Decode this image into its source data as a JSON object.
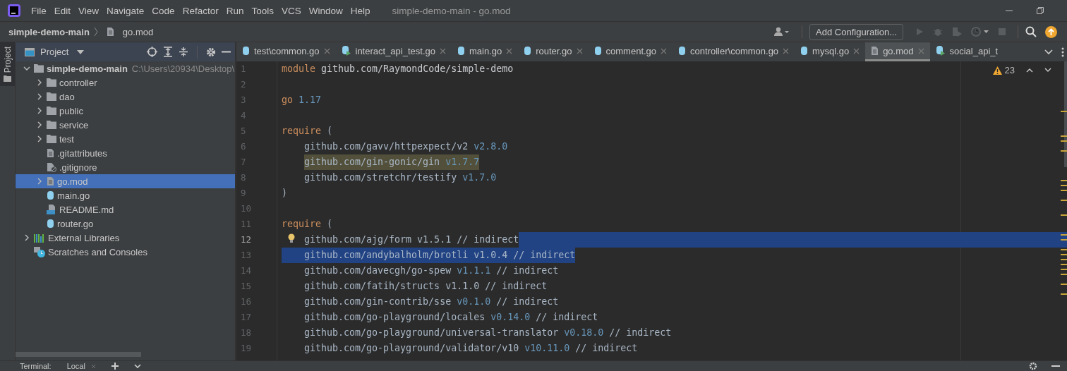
{
  "menu": [
    "File",
    "Edit",
    "View",
    "Navigate",
    "Code",
    "Refactor",
    "Run",
    "Tools",
    "VCS",
    "Window",
    "Help"
  ],
  "window_title": "simple-demo-main - go.mod",
  "breadcrumb": [
    {
      "label": "simple-demo-main",
      "kind": "project"
    },
    {
      "label": "go.mod",
      "kind": "file"
    }
  ],
  "toolbar": {
    "run_configuration": "Add Configuration..."
  },
  "side_tab": "Project",
  "project_panel": {
    "title": "Project",
    "tree": [
      {
        "label": "simple-demo-main",
        "path": "C:\\Users\\20934\\Desktop\\",
        "kind": "folder",
        "expanded": true,
        "selected": false,
        "children": [
          {
            "label": "controller",
            "kind": "folder",
            "expanded": false,
            "selected": false
          },
          {
            "label": "dao",
            "kind": "folder",
            "expanded": false,
            "selected": false
          },
          {
            "label": "public",
            "kind": "folder",
            "expanded": false,
            "selected": false
          },
          {
            "label": "service",
            "kind": "folder",
            "expanded": false,
            "selected": false
          },
          {
            "label": "test",
            "kind": "folder",
            "expanded": false,
            "selected": false
          },
          {
            "label": ".gitattributes",
            "kind": "file",
            "selected": false
          },
          {
            "label": ".gitignore",
            "kind": "ignored",
            "selected": false
          },
          {
            "label": "go.mod",
            "kind": "file",
            "expanded": false,
            "selected": true
          },
          {
            "label": "main.go",
            "kind": "go",
            "selected": false
          },
          {
            "label": "README.md",
            "kind": "markdown",
            "selected": false
          },
          {
            "label": "router.go",
            "kind": "go",
            "selected": false
          }
        ]
      },
      {
        "label": "External Libraries",
        "kind": "library",
        "expanded": false,
        "selected": false
      },
      {
        "label": "Scratches and Consoles",
        "kind": "scratches",
        "selected": false
      }
    ]
  },
  "tabs": [
    {
      "label": "test\\common.go",
      "kind": "go",
      "selected": false
    },
    {
      "label": "interact_api_test.go",
      "kind": "gotest",
      "selected": false
    },
    {
      "label": "main.go",
      "kind": "go",
      "selected": false
    },
    {
      "label": "router.go",
      "kind": "go",
      "selected": false
    },
    {
      "label": "comment.go",
      "kind": "go",
      "selected": false
    },
    {
      "label": "controller\\common.go",
      "kind": "go",
      "selected": false
    },
    {
      "label": "mysql.go",
      "kind": "go",
      "selected": false
    },
    {
      "label": "go.mod",
      "kind": "file",
      "selected": true
    },
    {
      "label": "social_api_t",
      "kind": "gotest",
      "selected": false
    }
  ],
  "editor": {
    "warnings": "23",
    "lines": [
      {
        "number": "1",
        "kind": "top",
        "tokens": [
          {
            "text": "module",
            "kind": "keyword"
          },
          {
            "text": " github.com/RaymondCode/simple-demo",
            "kind": "name"
          }
        ]
      },
      {
        "number": "2",
        "kind": "top"
      },
      {
        "number": "3",
        "kind": "top",
        "tokens": [
          {
            "text": "go",
            "kind": "keyword"
          },
          {
            "text": " 1.17",
            "kind": "version"
          }
        ]
      },
      {
        "number": "4",
        "kind": "top"
      },
      {
        "number": "5",
        "kind": "top",
        "tokens": [
          {
            "text": "require",
            "kind": "keyword"
          },
          {
            "text": " (",
            "kind": "text"
          }
        ]
      },
      {
        "number": "6",
        "kind": "nested",
        "tokens": [
          {
            "text": "github.com/gavv/httpexpect/v2 ",
            "kind": "text"
          },
          {
            "text": "v2.8.0",
            "kind": "version"
          }
        ]
      },
      {
        "number": "7",
        "kind": "nested",
        "highlight": true,
        "tokens": [
          {
            "text": "github.com/gin-gonic/gin ",
            "kind": "text"
          },
          {
            "text": "v1.7.7",
            "kind": "version"
          }
        ]
      },
      {
        "number": "8",
        "kind": "nested",
        "tokens": [
          {
            "text": "github.com/stretchr/testify ",
            "kind": "text"
          },
          {
            "text": "v1.7.0",
            "kind": "version"
          }
        ]
      },
      {
        "number": "9",
        "kind": "top",
        "tokens": [
          {
            "text": ")",
            "kind": "text"
          }
        ]
      },
      {
        "number": "10",
        "kind": "top"
      },
      {
        "number": "11",
        "kind": "top",
        "tokens": [
          {
            "text": "require",
            "kind": "keyword"
          },
          {
            "text": " (",
            "kind": "text"
          }
        ]
      },
      {
        "number": "12",
        "kind": "nested",
        "current": true,
        "selection_after": true,
        "bulb": true,
        "tokens": [
          {
            "text": "github.com/ajg/form v1.5.1 // indirect",
            "kind": "text"
          }
        ]
      },
      {
        "number": "13",
        "kind": "nested",
        "selected": true,
        "tokens": [
          {
            "text": "github.com/andybalholm/brotli v1.0.4 // indirect",
            "kind": "text"
          }
        ]
      },
      {
        "number": "14",
        "kind": "nested",
        "tokens": [
          {
            "text": "github.com/davecgh/go-spew ",
            "kind": "text"
          },
          {
            "text": "v1.1.1",
            "kind": "version"
          },
          {
            "text": " // indirect",
            "kind": "text"
          }
        ]
      },
      {
        "number": "15",
        "kind": "nested",
        "tokens": [
          {
            "text": "github.com/fatih/structs v1.1.0 // indirect",
            "kind": "text"
          }
        ]
      },
      {
        "number": "16",
        "kind": "nested",
        "tokens": [
          {
            "text": "github.com/gin-contrib/sse ",
            "kind": "text"
          },
          {
            "text": "v0.1.0",
            "kind": "version"
          },
          {
            "text": " // indirect",
            "kind": "text"
          }
        ]
      },
      {
        "number": "17",
        "kind": "nested",
        "tokens": [
          {
            "text": "github.com/go-playground/locales ",
            "kind": "text"
          },
          {
            "text": "v0.14.0",
            "kind": "version"
          },
          {
            "text": " // indirect",
            "kind": "text"
          }
        ]
      },
      {
        "number": "18",
        "kind": "nested",
        "tokens": [
          {
            "text": "github.com/go-playground/universal-translator ",
            "kind": "text"
          },
          {
            "text": "v0.18.0",
            "kind": "version"
          },
          {
            "text": " // indirect",
            "kind": "text"
          }
        ]
      },
      {
        "number": "19",
        "kind": "nested",
        "tokens": [
          {
            "text": "github.com/go-playground/validator/v10 ",
            "kind": "text"
          },
          {
            "text": "v10.11.0",
            "kind": "version"
          },
          {
            "text": " // indirect",
            "kind": "text"
          }
        ]
      }
    ]
  },
  "bottom_bar": {
    "tool": "Terminal:",
    "tab": "Local"
  }
}
